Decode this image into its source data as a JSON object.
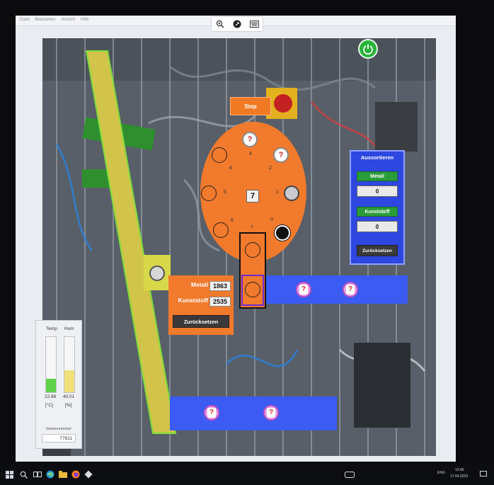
{
  "app": {
    "menu": [
      "Datei",
      "Bearbeiten",
      "Ansicht",
      "Hilfe"
    ],
    "toolbar": [
      "zoom-in-icon",
      "pin-icon",
      "keyboard-icon"
    ]
  },
  "colors": {
    "orange": "#f27a2c",
    "blue_panel": "#2d47e0",
    "belt_blue": "#3b5bf2",
    "belt_yellow": "#d8c24a",
    "green": "#2a9c3a",
    "temp_fill": "#5fd34a",
    "hum_fill": "#efe07a"
  },
  "controls": {
    "power_icon": "power-icon",
    "step_label": "Step"
  },
  "carousel": {
    "slots": [
      {
        "num": "0",
        "kind": "black"
      },
      {
        "num": "1",
        "kind": "grey"
      },
      {
        "num": "2",
        "kind": "question"
      },
      {
        "num": "3",
        "kind": "question"
      },
      {
        "num": "4",
        "kind": "empty"
      },
      {
        "num": "5",
        "kind": "empty"
      },
      {
        "num": "6",
        "kind": "empty"
      },
      {
        "num": "7",
        "kind": "empty"
      }
    ],
    "position": "7",
    "question_glyph": "?"
  },
  "counter": {
    "metall_label": "Metall",
    "metall_value": "1863",
    "kunststoff_label": "Kunststoff",
    "kunststoff_value": "2535",
    "reset_label": "Zurücksetzen"
  },
  "sorting": {
    "title": "Aussortieren",
    "metall_label": "Metall",
    "metall_value": "0",
    "kunststoff_label": "Kunststoff",
    "kunststoff_value": "0",
    "reset_label": "Zurücksetzen"
  },
  "sensors": {
    "temp_label": "Temp",
    "hum_label": "Hum",
    "temp_value": "22.88",
    "hum_value": "40.01",
    "temp_unit": "[°C]",
    "hum_unit": "[%]",
    "temp_level": 0.25,
    "hum_level": 0.4,
    "serial_label": "Seriennummer",
    "serial_value": "77811"
  },
  "taskbar": {
    "time": "13:46",
    "date": "17.04.2023",
    "lang": "ENG"
  }
}
